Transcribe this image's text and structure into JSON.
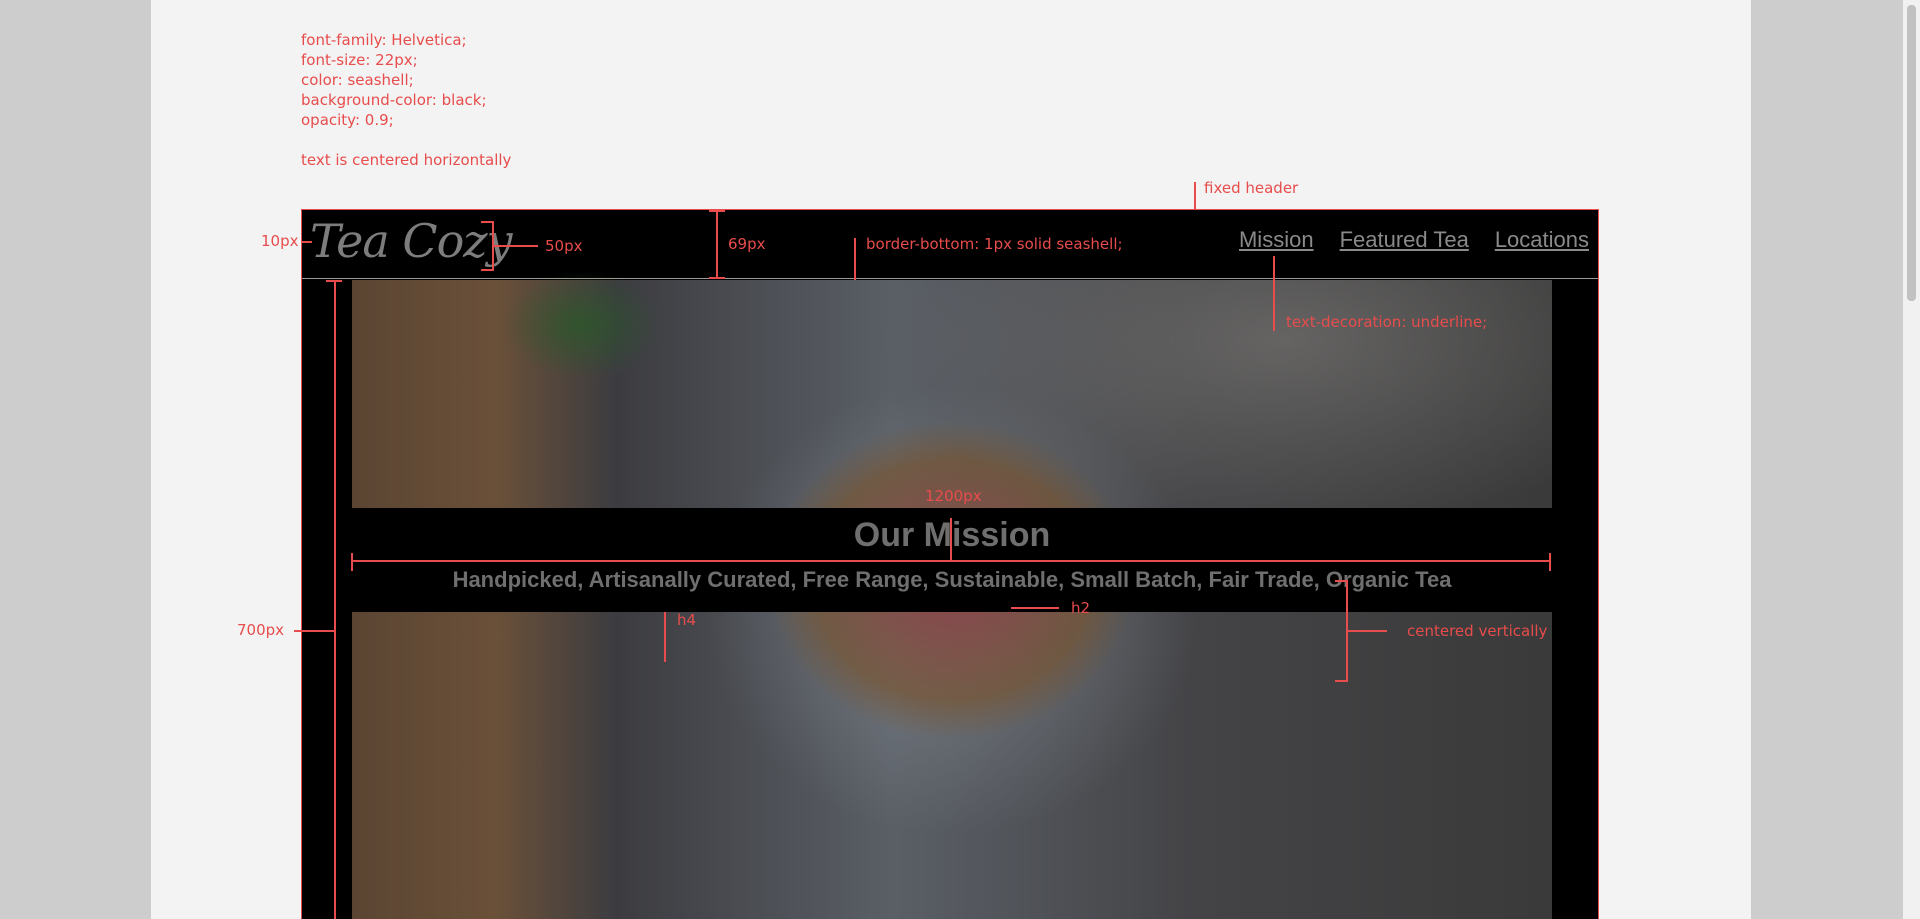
{
  "specs": {
    "line1": "font-family: Helvetica;",
    "line2": "font-size: 22px;",
    "line3": "color: seashell;",
    "line4": "background-color: black;",
    "line5": "opacity: 0.9;",
    "line6": "text is centered horizontally"
  },
  "annotations": {
    "fixed_header": "fixed header",
    "ten_px": "10px",
    "fifty_px": "50px",
    "sixtynine_px": "69px",
    "border_bottom": "border-bottom: 1px solid seashell;",
    "text_decoration": "text-decoration: underline;",
    "twelve_hundred": "1200px",
    "h2_tag": "h2",
    "h4_tag": "h4",
    "centered_vertically": "centered vertically",
    "seven_hundred": "700px"
  },
  "header": {
    "logo": "Tea Cozy",
    "nav": [
      "Mission",
      "Featured Tea",
      "Locations"
    ]
  },
  "mission": {
    "title": "Our Mission",
    "subtitle": "Handpicked, Artisanally Curated, Free Range, Sustainable, Small Batch, Fair Trade, Organic Tea"
  },
  "colors": {
    "annotation": "#e84c4c",
    "page_bg": "#f3f3f3",
    "mockup_bg": "#000000"
  }
}
